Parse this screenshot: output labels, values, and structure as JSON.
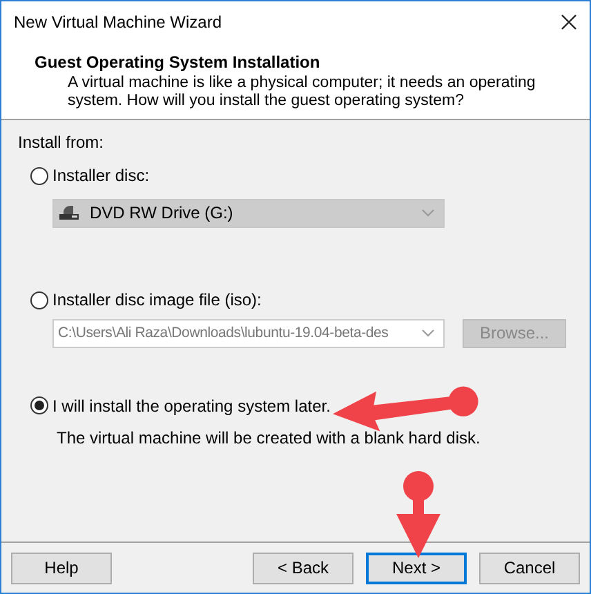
{
  "window": {
    "title": "New Virtual Machine Wizard"
  },
  "header": {
    "title": "Guest Operating System Installation",
    "description": "A virtual machine is like a physical computer; it needs an operating system. How will you install the guest operating system?"
  },
  "install_from": "Install from:",
  "options": [
    {
      "kind": "disc",
      "label": "Installer disc:",
      "selected": false,
      "dropdown": {
        "value": "DVD RW Drive (G:)",
        "disabled": true
      }
    },
    {
      "kind": "iso",
      "label": "Installer disc image file (iso):",
      "selected": false,
      "field": {
        "value": "C:\\Users\\Ali Raza\\Downloads\\lubuntu-19.04-beta-des",
        "disabled": true
      },
      "browse": {
        "label": "Browse...",
        "disabled": true
      }
    },
    {
      "kind": "later",
      "label": "I will install the operating system later.",
      "selected": true,
      "note": "The virtual machine will be created with a blank hard disk."
    }
  ],
  "help_button": {
    "label": "Help"
  },
  "buttons": [
    {
      "label": "< Back",
      "focused": false
    },
    {
      "label": "Next >",
      "focused": true
    },
    {
      "label": "Cancel",
      "focused": false
    }
  ]
}
